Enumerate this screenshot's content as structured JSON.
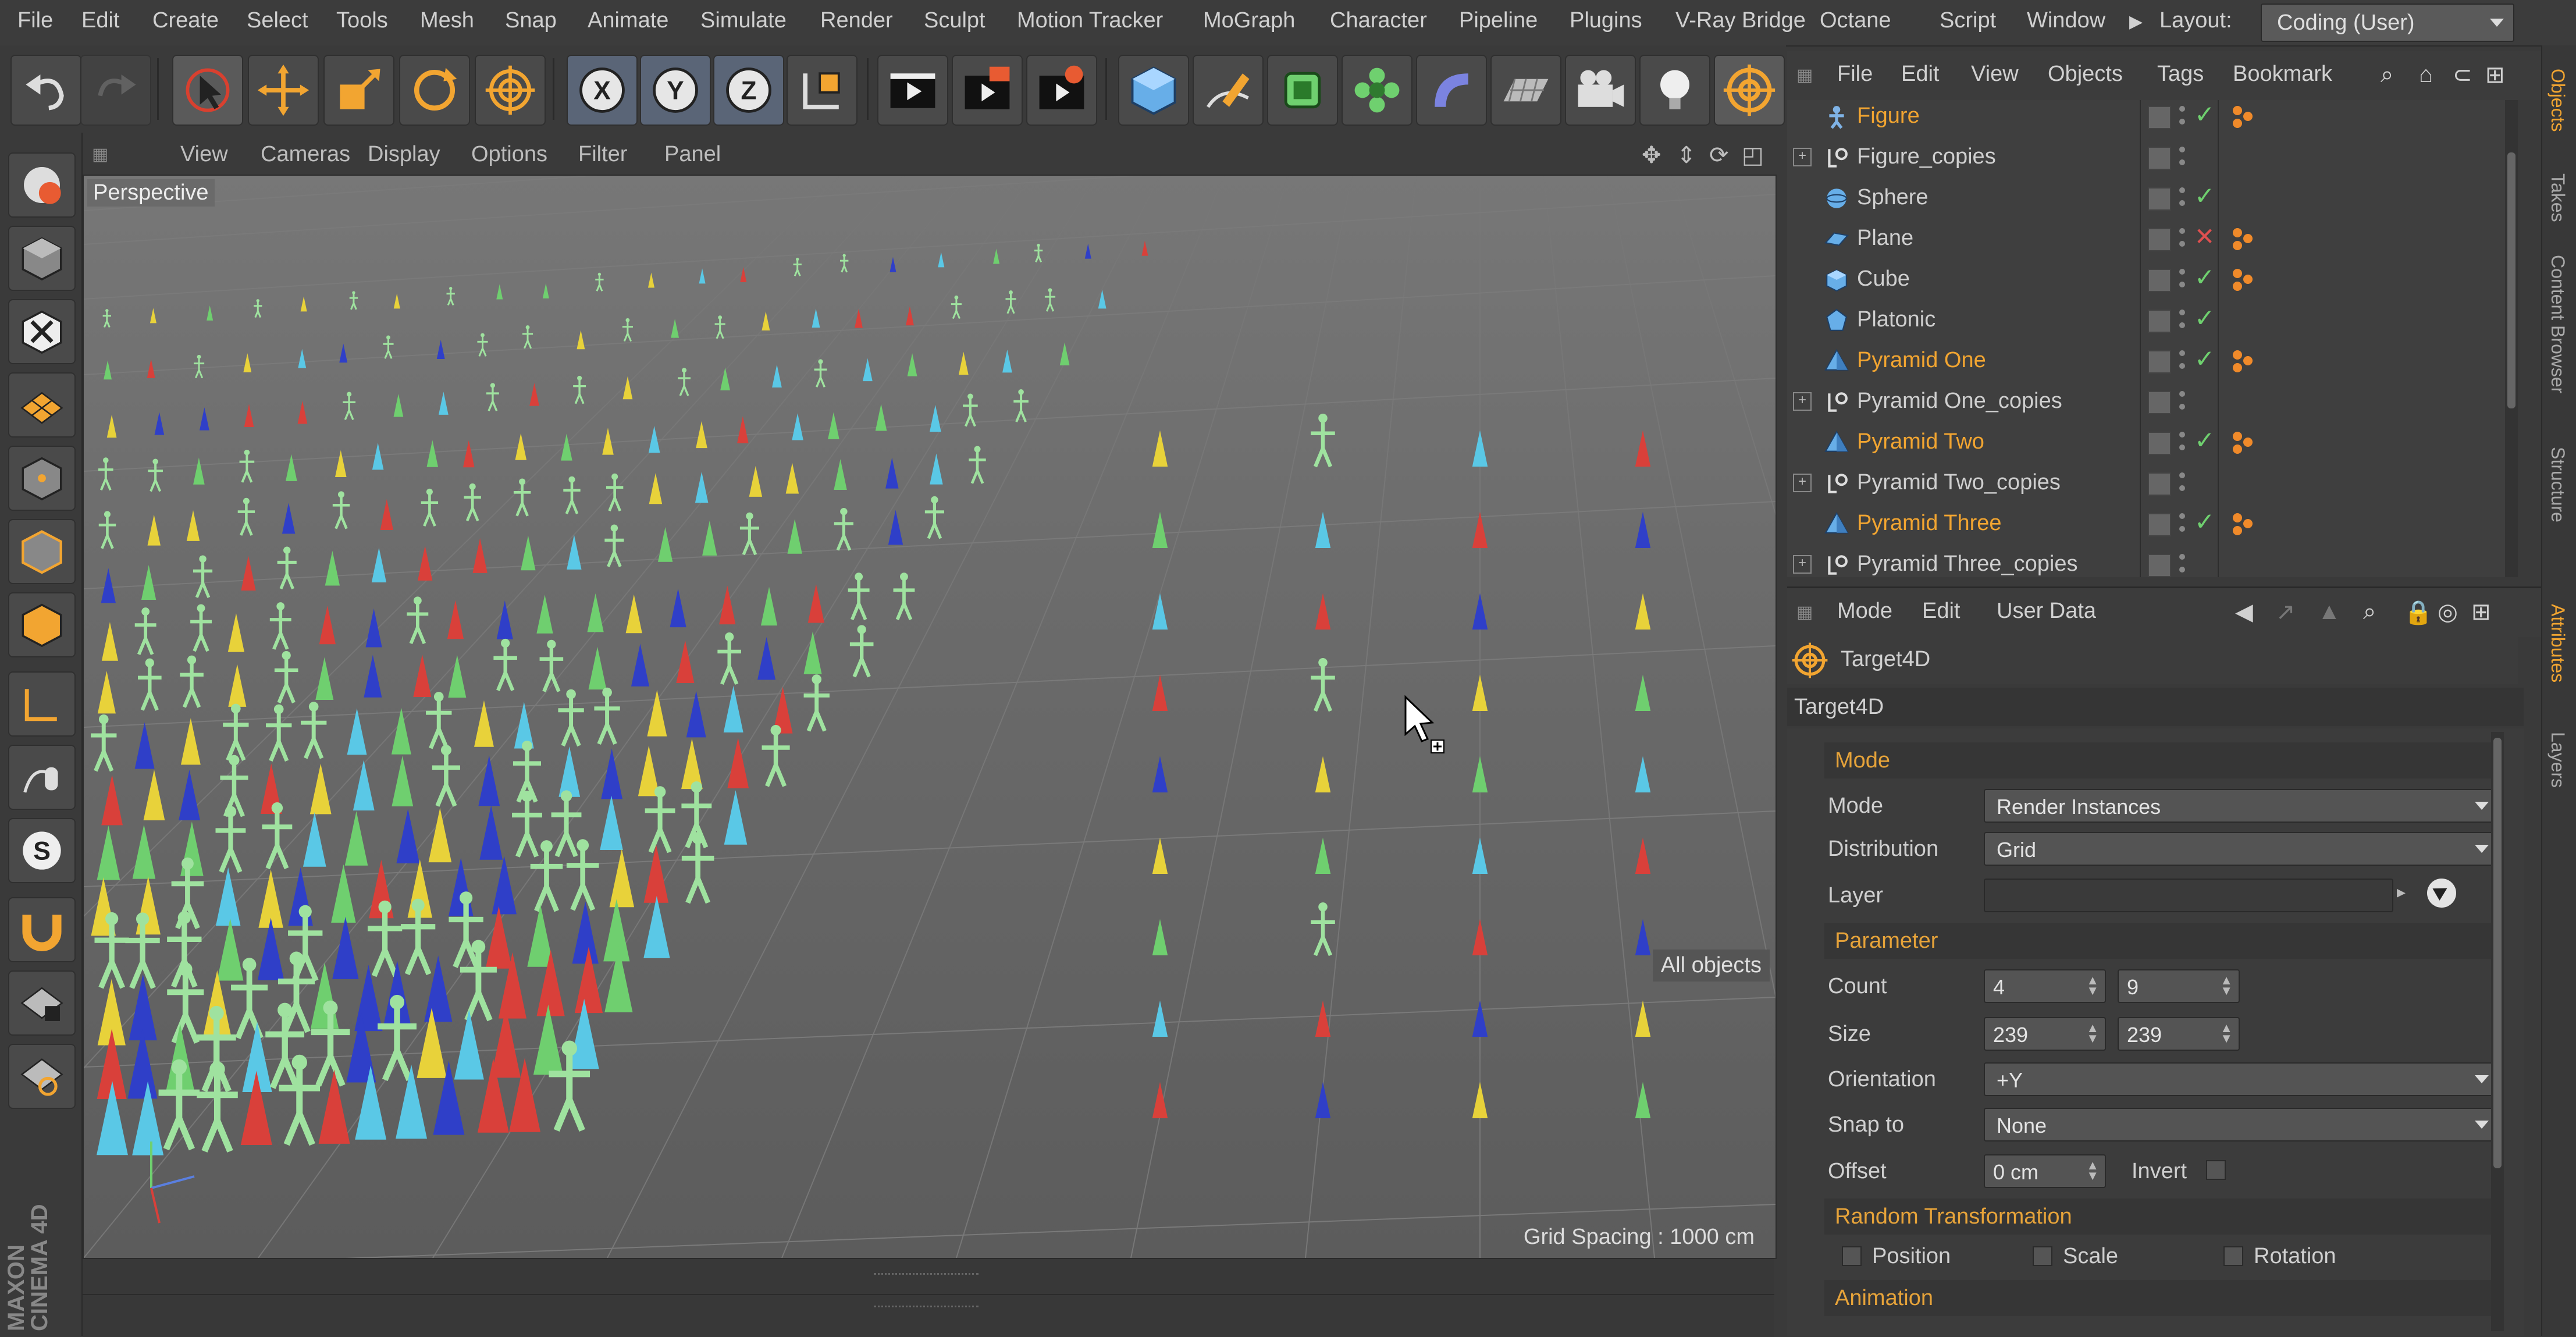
{
  "menubar": {
    "items": [
      "File",
      "Edit",
      "Create",
      "Select",
      "Tools",
      "Mesh",
      "Snap",
      "Animate",
      "Simulate",
      "Render",
      "Sculpt",
      "Motion Tracker",
      "MoGraph",
      "Character",
      "Pipeline",
      "Plugins",
      "V-Ray Bridge",
      "Octane",
      "Script",
      "Window"
    ],
    "layout_label": "Layout:",
    "layout_value": "Coding (User)"
  },
  "toolbar": {
    "icons": [
      "undo-icon",
      "redo-icon",
      "live-selection-icon",
      "move-icon",
      "scale-icon",
      "rotate-icon",
      "target-icon",
      "x-axis-icon",
      "y-axis-icon",
      "z-axis-icon",
      "coordinate-system-icon",
      "render-view-icon",
      "render-picture-viewer-icon",
      "render-settings-icon",
      "cube-icon",
      "pen-icon",
      "subdivision-icon",
      "cloner-icon",
      "deformer-icon",
      "floor-icon",
      "camera-icon",
      "light-icon",
      "target4d-icon"
    ],
    "axis_labels": {
      "x": "X",
      "y": "Y",
      "z": "Z"
    }
  },
  "viewport": {
    "menus": [
      "View",
      "Cameras",
      "Display",
      "Options",
      "Filter",
      "Panel"
    ],
    "camera_label": "Perspective",
    "filter_badge": "All objects",
    "grid_spacing": "Grid Spacing : 1000 cm"
  },
  "left_brand": "MAXON CINEMA 4D",
  "object_manager": {
    "menus": [
      "File",
      "Edit",
      "View",
      "Objects",
      "Tags",
      "Bookmark"
    ],
    "objects": [
      {
        "name": "Figure",
        "highlight": true,
        "expander": false,
        "icon": "figure-icon",
        "state": "check",
        "tag": true
      },
      {
        "name": "Figure_copies",
        "highlight": false,
        "expander": true,
        "icon": "null-icon",
        "state": "none",
        "tag": false
      },
      {
        "name": "Sphere",
        "highlight": false,
        "expander": false,
        "icon": "sphere-icon",
        "state": "check",
        "tag": false
      },
      {
        "name": "Plane",
        "highlight": false,
        "expander": false,
        "icon": "plane-icon",
        "state": "x",
        "tag": true
      },
      {
        "name": "Cube",
        "highlight": false,
        "expander": false,
        "icon": "cube-icon",
        "state": "check",
        "tag": true
      },
      {
        "name": "Platonic",
        "highlight": false,
        "expander": false,
        "icon": "platonic-icon",
        "state": "check",
        "tag": false
      },
      {
        "name": "Pyramid One",
        "highlight": true,
        "expander": false,
        "icon": "pyramid-icon",
        "state": "check",
        "tag": true
      },
      {
        "name": "Pyramid One_copies",
        "highlight": false,
        "expander": true,
        "icon": "null-icon",
        "state": "none",
        "tag": false
      },
      {
        "name": "Pyramid Two",
        "highlight": true,
        "expander": false,
        "icon": "pyramid-icon",
        "state": "check",
        "tag": true
      },
      {
        "name": "Pyramid Two_copies",
        "highlight": false,
        "expander": true,
        "icon": "null-icon",
        "state": "none",
        "tag": false
      },
      {
        "name": "Pyramid Three",
        "highlight": true,
        "expander": false,
        "icon": "pyramid-icon",
        "state": "check",
        "tag": true
      },
      {
        "name": "Pyramid Three_copies",
        "highlight": false,
        "expander": true,
        "icon": "null-icon",
        "state": "none",
        "tag": false
      }
    ]
  },
  "attributes": {
    "menus": [
      "Mode",
      "Edit",
      "User Data"
    ],
    "object_name": "Target4D",
    "title": "Target4D",
    "sections": {
      "mode": "Mode",
      "parameter": "Parameter",
      "random": "Random Transformation",
      "animation": "Animation"
    },
    "mode_label": "Mode",
    "mode_value": "Render Instances",
    "distribution_label": "Distribution",
    "distribution_value": "Grid",
    "layer_label": "Layer",
    "count_label": "Count",
    "count_x": "4",
    "count_y": "9",
    "size_label": "Size",
    "size_x": "239",
    "size_y": "239",
    "orientation_label": "Orientation",
    "orientation_value": "+Y",
    "snap_label": "Snap to",
    "snap_value": "None",
    "offset_label": "Offset",
    "offset_value": "0 cm",
    "invert_label": "Invert",
    "random_position": "Position",
    "random_scale": "Scale",
    "random_rotation": "Rotation"
  },
  "side_tabs": [
    "Objects",
    "Takes",
    "Content Browser",
    "Structure",
    "Attributes",
    "Layers"
  ],
  "colors": {
    "accent": "#f2a531",
    "cone_yellow": "#e8d23a",
    "cone_green": "#6fcf6f",
    "cone_cyan": "#5ac8e6",
    "cone_red": "#d9403a",
    "cone_blue": "#2f3fc8",
    "figure_green": "#9fe29f"
  }
}
